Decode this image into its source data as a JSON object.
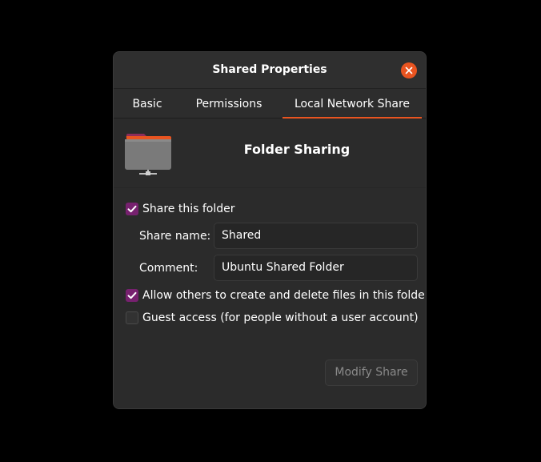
{
  "dialog": {
    "title": "Shared Properties"
  },
  "tabs": [
    {
      "label": "Basic",
      "active": false
    },
    {
      "label": "Permissions",
      "active": false
    },
    {
      "label": "Local Network Share",
      "active": true
    }
  ],
  "header": {
    "icon": "folder-network-icon",
    "title": "Folder Sharing"
  },
  "share": {
    "share_folder_label": "Share this folder",
    "share_folder_checked": true,
    "share_name_label": "Share name:",
    "share_name_value": "Shared",
    "comment_label": "Comment:",
    "comment_value": "Ubuntu Shared Folder",
    "allow_others_label": "Allow others to create and delete files in this folder",
    "allow_others_checked": true,
    "guest_access_label": "Guest access (for people without a user account)",
    "guest_access_checked": false
  },
  "actions": {
    "modify_label": "Modify Share"
  },
  "colors": {
    "accent": "#e95420",
    "checkbox": "#77216f",
    "background": "#2b2b2b"
  }
}
